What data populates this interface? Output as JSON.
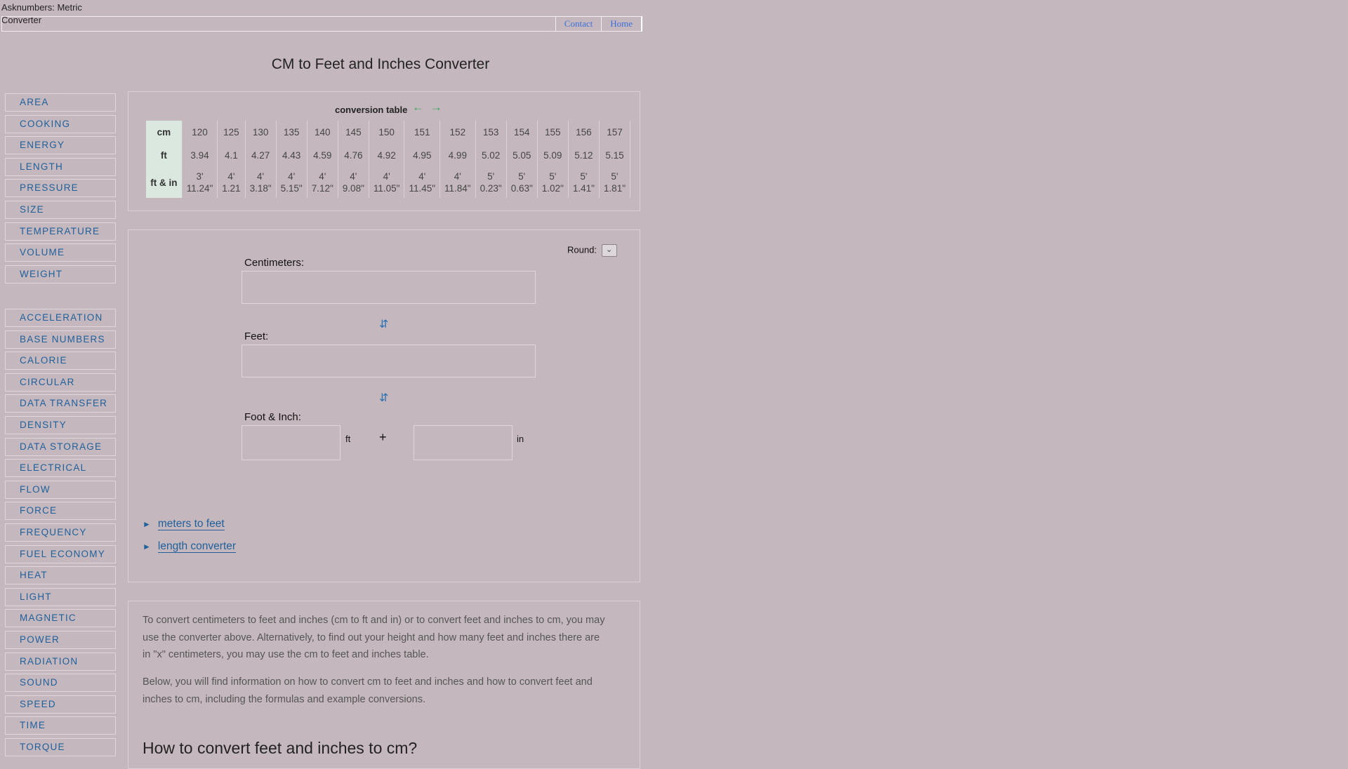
{
  "header": {
    "logo_alt": "Asknumbers: Metric Converter",
    "nav": {
      "contact": "Contact",
      "home": "Home"
    }
  },
  "page_title": "CM to Feet and Inches Converter",
  "sidebar": {
    "group1": [
      "AREA",
      "COOKING",
      "ENERGY",
      "LENGTH",
      "PRESSURE",
      "SIZE",
      "TEMPERATURE",
      "VOLUME",
      "WEIGHT"
    ],
    "group2": [
      "ACCELERATION",
      "BASE NUMBERS",
      "CALORIE",
      "CIRCULAR",
      "DATA TRANSFER",
      "DENSITY",
      "DATA STORAGE",
      "ELECTRICAL",
      "FLOW",
      "FORCE",
      "FREQUENCY",
      "FUEL ECONOMY",
      "HEAT",
      "LIGHT",
      "MAGNETIC",
      "POWER",
      "RADIATION",
      "SOUND",
      "SPEED",
      "TIME",
      "TORQUE"
    ]
  },
  "conversion_table": {
    "title": "conversion table",
    "arrows": "← →",
    "row_headers": [
      "cm",
      "ft",
      "ft & in"
    ],
    "cm": [
      "120",
      "125",
      "130",
      "135",
      "140",
      "145",
      "150",
      "151",
      "152",
      "153",
      "154",
      "155",
      "156",
      "157"
    ],
    "ft": [
      "3.94",
      "4.1",
      "4.27",
      "4.43",
      "4.59",
      "4.76",
      "4.92",
      "4.95",
      "4.99",
      "5.02",
      "5.05",
      "5.09",
      "5.12",
      "5.15"
    ],
    "ftin_feet": [
      "3'",
      "4'",
      "4'",
      "4'",
      "4'",
      "4'",
      "4'",
      "4'",
      "4'",
      "5'",
      "5'",
      "5'",
      "5'",
      "5'"
    ],
    "ftin_inches": [
      "11.24\"",
      "1.21",
      "3.18\"",
      "5.15\"",
      "7.12\"",
      "9.08\"",
      "11.05\"",
      "11.45\"",
      "11.84\"",
      "0.23\"",
      "0.63\"",
      "1.02\"",
      "1.41\"",
      "1.81\""
    ]
  },
  "converter": {
    "round_label": "Round:",
    "round_value": "",
    "cm_label": "Centimeters:",
    "feet_label": "Feet:",
    "footinch_label": "Foot & Inch:",
    "ft_unit": "ft",
    "in_unit": "in",
    "plus": "+",
    "swap_glyph": "⇵",
    "cm_value": "",
    "feet_value": "",
    "ft_value": "",
    "in_value": ""
  },
  "links": [
    {
      "label": "meters to feet"
    },
    {
      "label": "length converter"
    }
  ],
  "article": {
    "para1": "To convert centimeters to feet and inches (cm to ft and in) or to convert feet and inches to cm, you may use the converter above. Alternatively, to find out your height and how many feet and inches there are in \"x\" centimeters, you may use the cm to feet and inches table.",
    "para2": "Below, you will find information on how to convert cm to feet and inches and how to convert feet and inches to cm, including the formulas and example conversions.",
    "heading": "How to convert feet and inches to cm?"
  }
}
